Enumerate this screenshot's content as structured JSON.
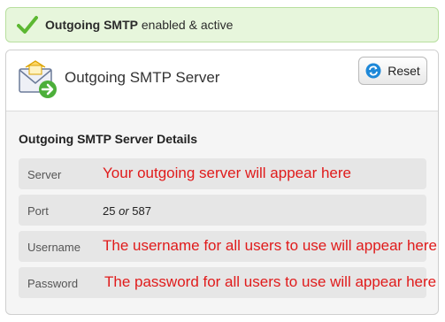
{
  "banner": {
    "title": "Outgoing SMTP",
    "status": "enabled & active",
    "icon": "checkmark-icon"
  },
  "panel": {
    "title": "Outgoing SMTP Server",
    "icon": "mail-forward-icon",
    "reset_label": "Reset",
    "reset_icon": "refresh-icon"
  },
  "details": {
    "title": "Outgoing SMTP Server Details",
    "rows": [
      {
        "label": "Server",
        "value": "Your outgoing server will appear here"
      },
      {
        "label": "Port",
        "value_a": "25",
        "value_sep": "or",
        "value_b": "587"
      },
      {
        "label": "Username",
        "value": "The username for all users to use will appear here"
      },
      {
        "label": "Password",
        "value": "The password for all users to use will appear here"
      }
    ]
  },
  "colors": {
    "banner_bg": "#e7f6dc",
    "check_green": "#5cb832",
    "hint_red": "#e01b1b",
    "reset_blue": "#1e88d8"
  }
}
